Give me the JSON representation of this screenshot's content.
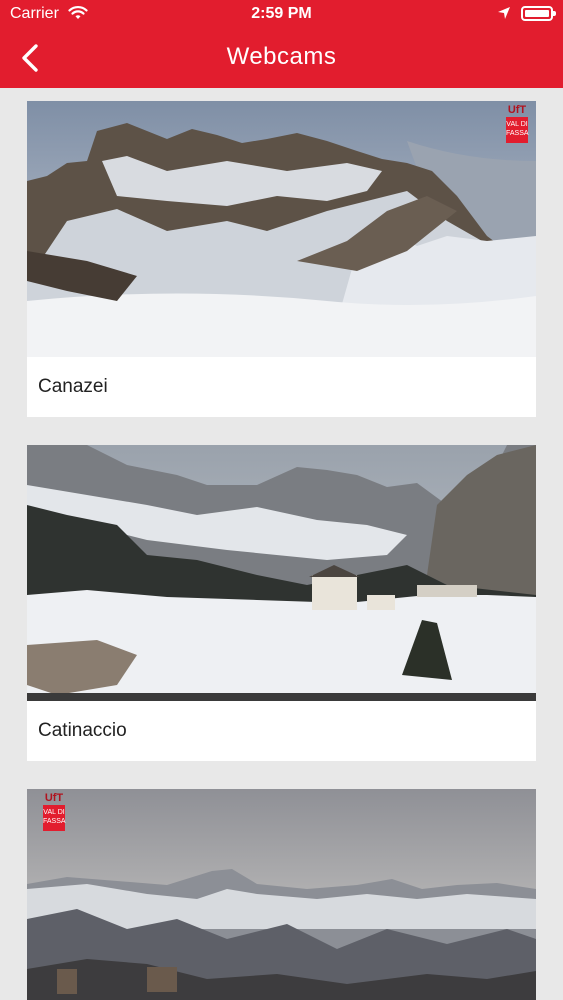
{
  "status_bar": {
    "carrier": "Carrier",
    "time": "2:59 PM"
  },
  "header": {
    "title": "Webcams"
  },
  "webcams": [
    {
      "label": "Canazei"
    },
    {
      "label": "Catinaccio"
    },
    {
      "label": ""
    }
  ],
  "logo": {
    "mark": "UfT",
    "text": "VAL DI FASSA"
  },
  "colors": {
    "header": "#e21d2e",
    "background": "#e8e8e8"
  }
}
